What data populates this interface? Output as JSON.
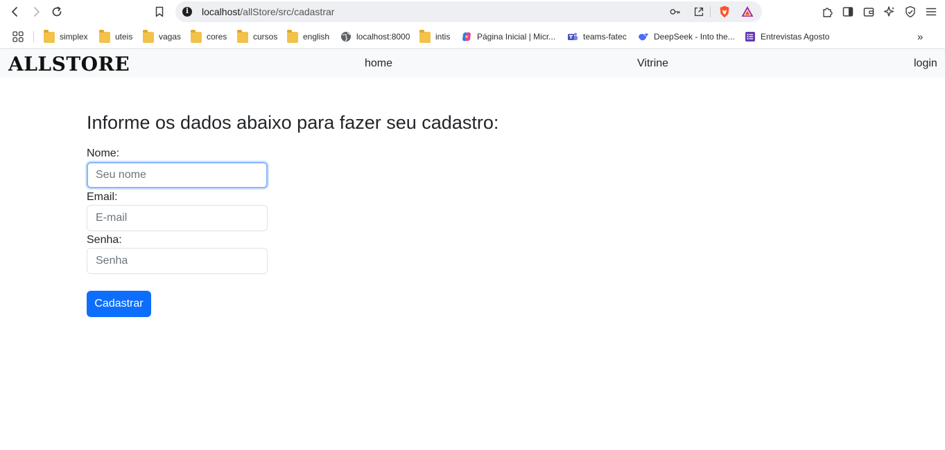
{
  "browser": {
    "url_host": "localhost",
    "url_path": "/allStore/src/cadastrar",
    "bookmarks": [
      {
        "label": "simplex",
        "icon": "folder-icon"
      },
      {
        "label": "uteis",
        "icon": "folder-icon"
      },
      {
        "label": "vagas",
        "icon": "folder-icon"
      },
      {
        "label": "cores",
        "icon": "folder-icon"
      },
      {
        "label": "cursos",
        "icon": "folder-icon"
      },
      {
        "label": "english",
        "icon": "folder-icon"
      },
      {
        "label": "localhost:8000",
        "icon": "globe-icon"
      },
      {
        "label": "intis",
        "icon": "folder-icon"
      },
      {
        "label": "Página Inicial | Micr...",
        "icon": "copilot-icon"
      },
      {
        "label": "teams-fatec",
        "icon": "teams-icon"
      },
      {
        "label": "DeepSeek - Into the...",
        "icon": "deepseek-icon"
      },
      {
        "label": "Entrevistas Agosto",
        "icon": "forms-icon"
      }
    ],
    "overflow": "»"
  },
  "navbar": {
    "brand": "ALLSTORE",
    "links": [
      "home",
      "Vitrine",
      "login"
    ]
  },
  "form": {
    "heading": "Informe os dados abaixo para fazer seu cadastro:",
    "name_label": "Nome:",
    "name_placeholder": "Seu nome",
    "email_label": "Email:",
    "email_placeholder": "E-mail",
    "password_label": "Senha:",
    "password_placeholder": "Senha",
    "submit_label": "Cadastrar"
  },
  "colors": {
    "primary": "#0d6efd",
    "navbar_bg": "#f8f9fa",
    "focus_ring": "#86b7fe"
  }
}
